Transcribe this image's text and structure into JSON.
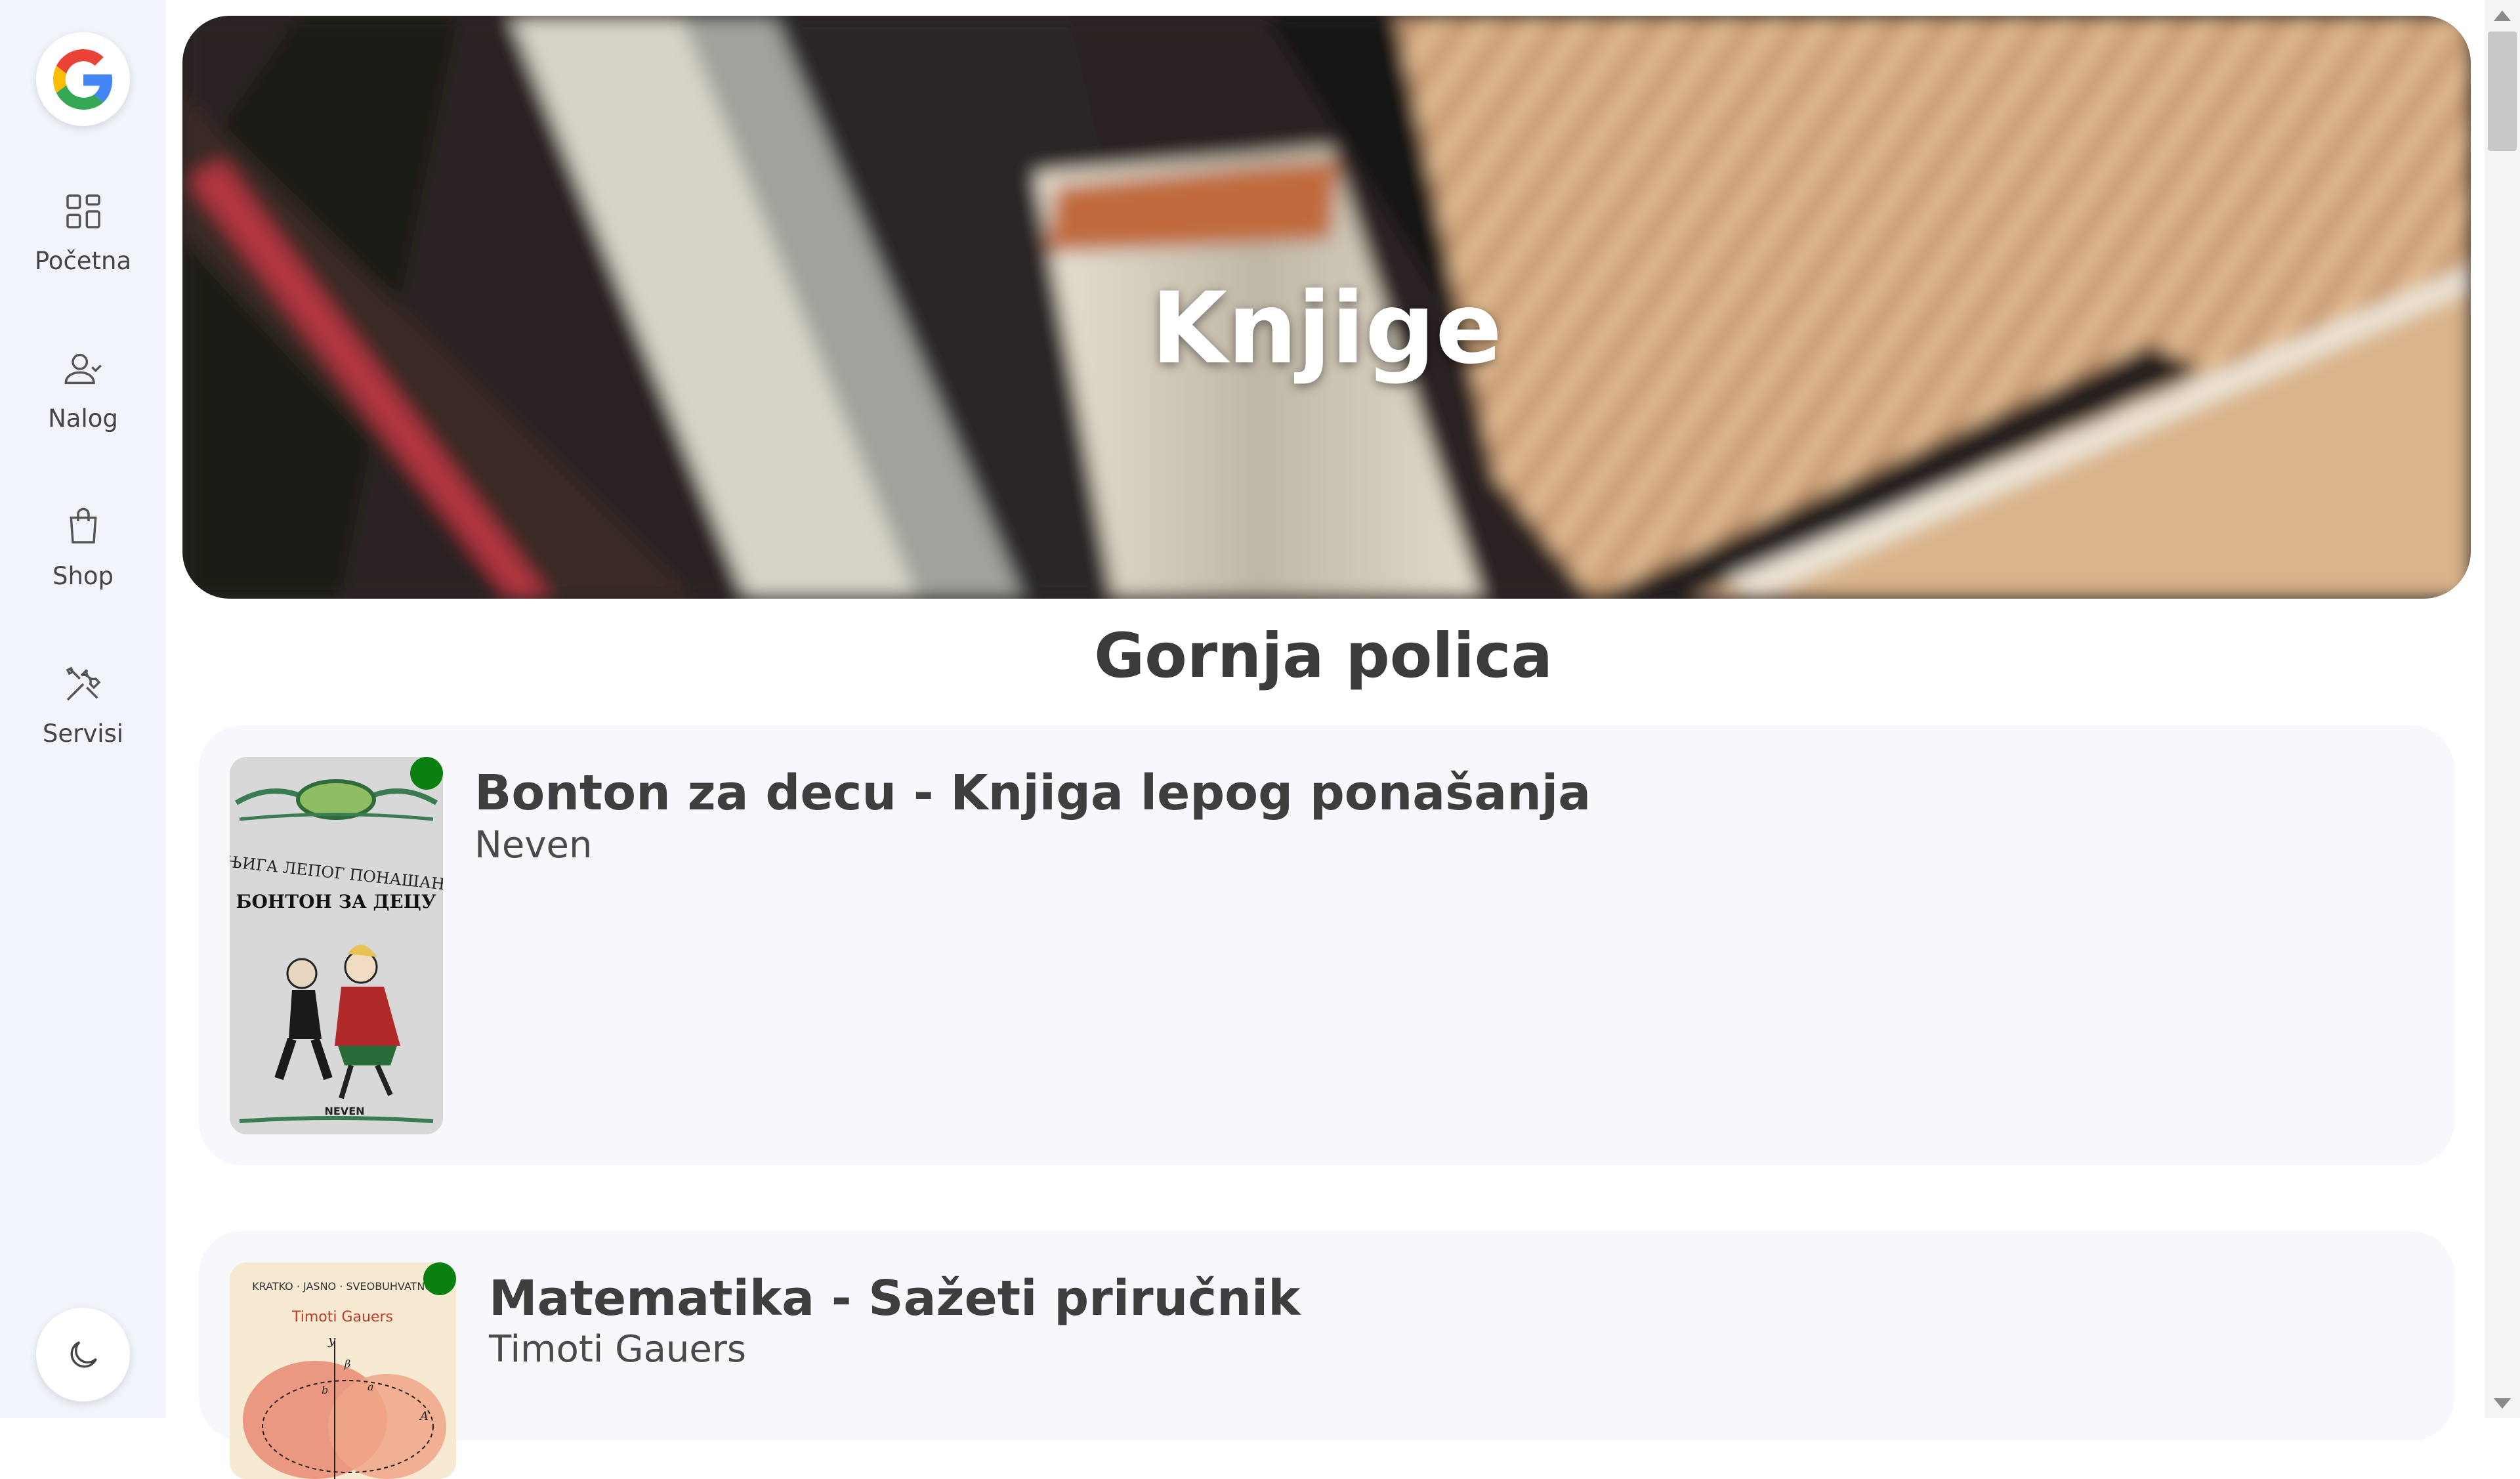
{
  "sidebar": {
    "items": [
      {
        "label": "Početna",
        "icon": "grid-icon"
      },
      {
        "label": "Nalog",
        "icon": "user-icon"
      },
      {
        "label": "Shop",
        "icon": "shopping-bag-icon"
      },
      {
        "label": "Servisi",
        "icon": "tools-icon"
      }
    ],
    "theme_icon": "moon-icon"
  },
  "hero": {
    "title": "Knjige"
  },
  "shelf": {
    "title": "Gornja polica",
    "books": [
      {
        "title": "Bonton za decu - Knjiga lepog ponašanja",
        "author": "Neven",
        "status_color": "#0a8010",
        "cover": {
          "line1": "КЊИГА ЛЕПОГ ПОНАШАЊА",
          "line2": "БОНТОН ЗА ДЕЦУ",
          "publisher": "NEVEN"
        }
      },
      {
        "title": "Matematika - Sažeti priručnik",
        "author": "Timoti Gauers",
        "status_color": "#0a8010",
        "cover": {
          "line1": "KRATKO · JASNO · SVEOBUHVATNO",
          "line2": "Timoti Gauers",
          "axis_y": "y",
          "axis_b": "β",
          "axis_a": "a",
          "axis_b2": "b",
          "axis_A": "A"
        }
      }
    ]
  },
  "colors": {
    "sidebar_bg": "#f1f4fb",
    "card_bg": "#f7f8fc",
    "status_green": "#0a8010"
  }
}
